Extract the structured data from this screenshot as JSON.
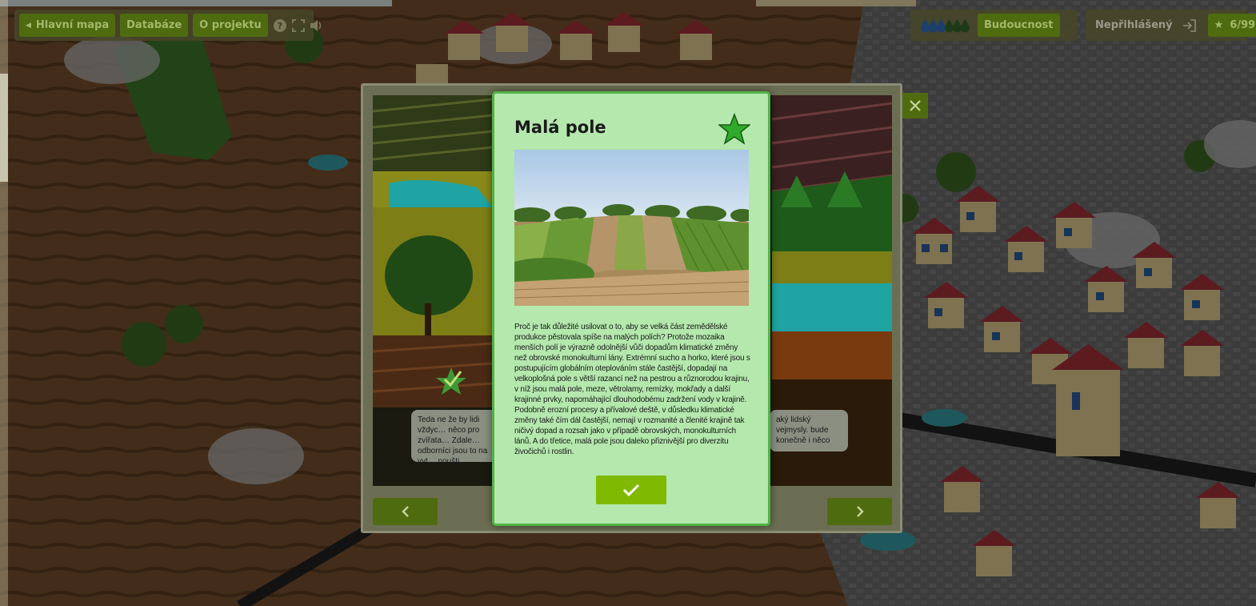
{
  "topbar": {
    "main_map_label": "Hlavní mapa",
    "database_label": "Databáze",
    "about_label": "O projektu",
    "future_label": "Budoucnost",
    "login_label": "Nepřihlášený",
    "score_label": "6/99",
    "water_drops_filled": 3,
    "water_drops_total": 6
  },
  "modal": {
    "bubble_left_text": "Teda ne že by lidi vždyc… něco pro zvířata… Zdale… odborníci jsou to na vyt… poušti.",
    "bubble_right_text": "aký lidský vejmysly. bude konečně i něco"
  },
  "card": {
    "title": "Malá pole",
    "body": "Proč je tak důležité usilovat o to, aby se velká část zemědělské produkce pěstovala spíše na malých polích? Protože mozaika menších polí je výrazně odolnější vůči dopadům klimatické změny než obrovské monokulturní lány. Extrémní sucho a horko, které jsou s postupujícím globálním oteplováním stále častější, dopadají na velkoplošná pole s větší razancí než na pestrou a různorodou krajinu, v níž jsou malá pole, meze, větrolamy, remízky, mokřady a další krajinné prvky, napomáhající dlouhodobému zadržení vody v krajině. Podobně erozní procesy a přívalové deště, v důsledku klimatické změny také čím dál častější, nemají v rozmanité a členité krajině tak ničivý dopad a rozsah jako v případě obrovských, monokulturních lánů. A do třetice, malá pole jsou daleko přiznivější pro diverzitu živočichů i rostlin."
  },
  "colors": {
    "accent": "#4f6b0f",
    "card_bg": "#b4e8ad",
    "card_border": "#52b347",
    "ok_button": "#7fba00"
  }
}
